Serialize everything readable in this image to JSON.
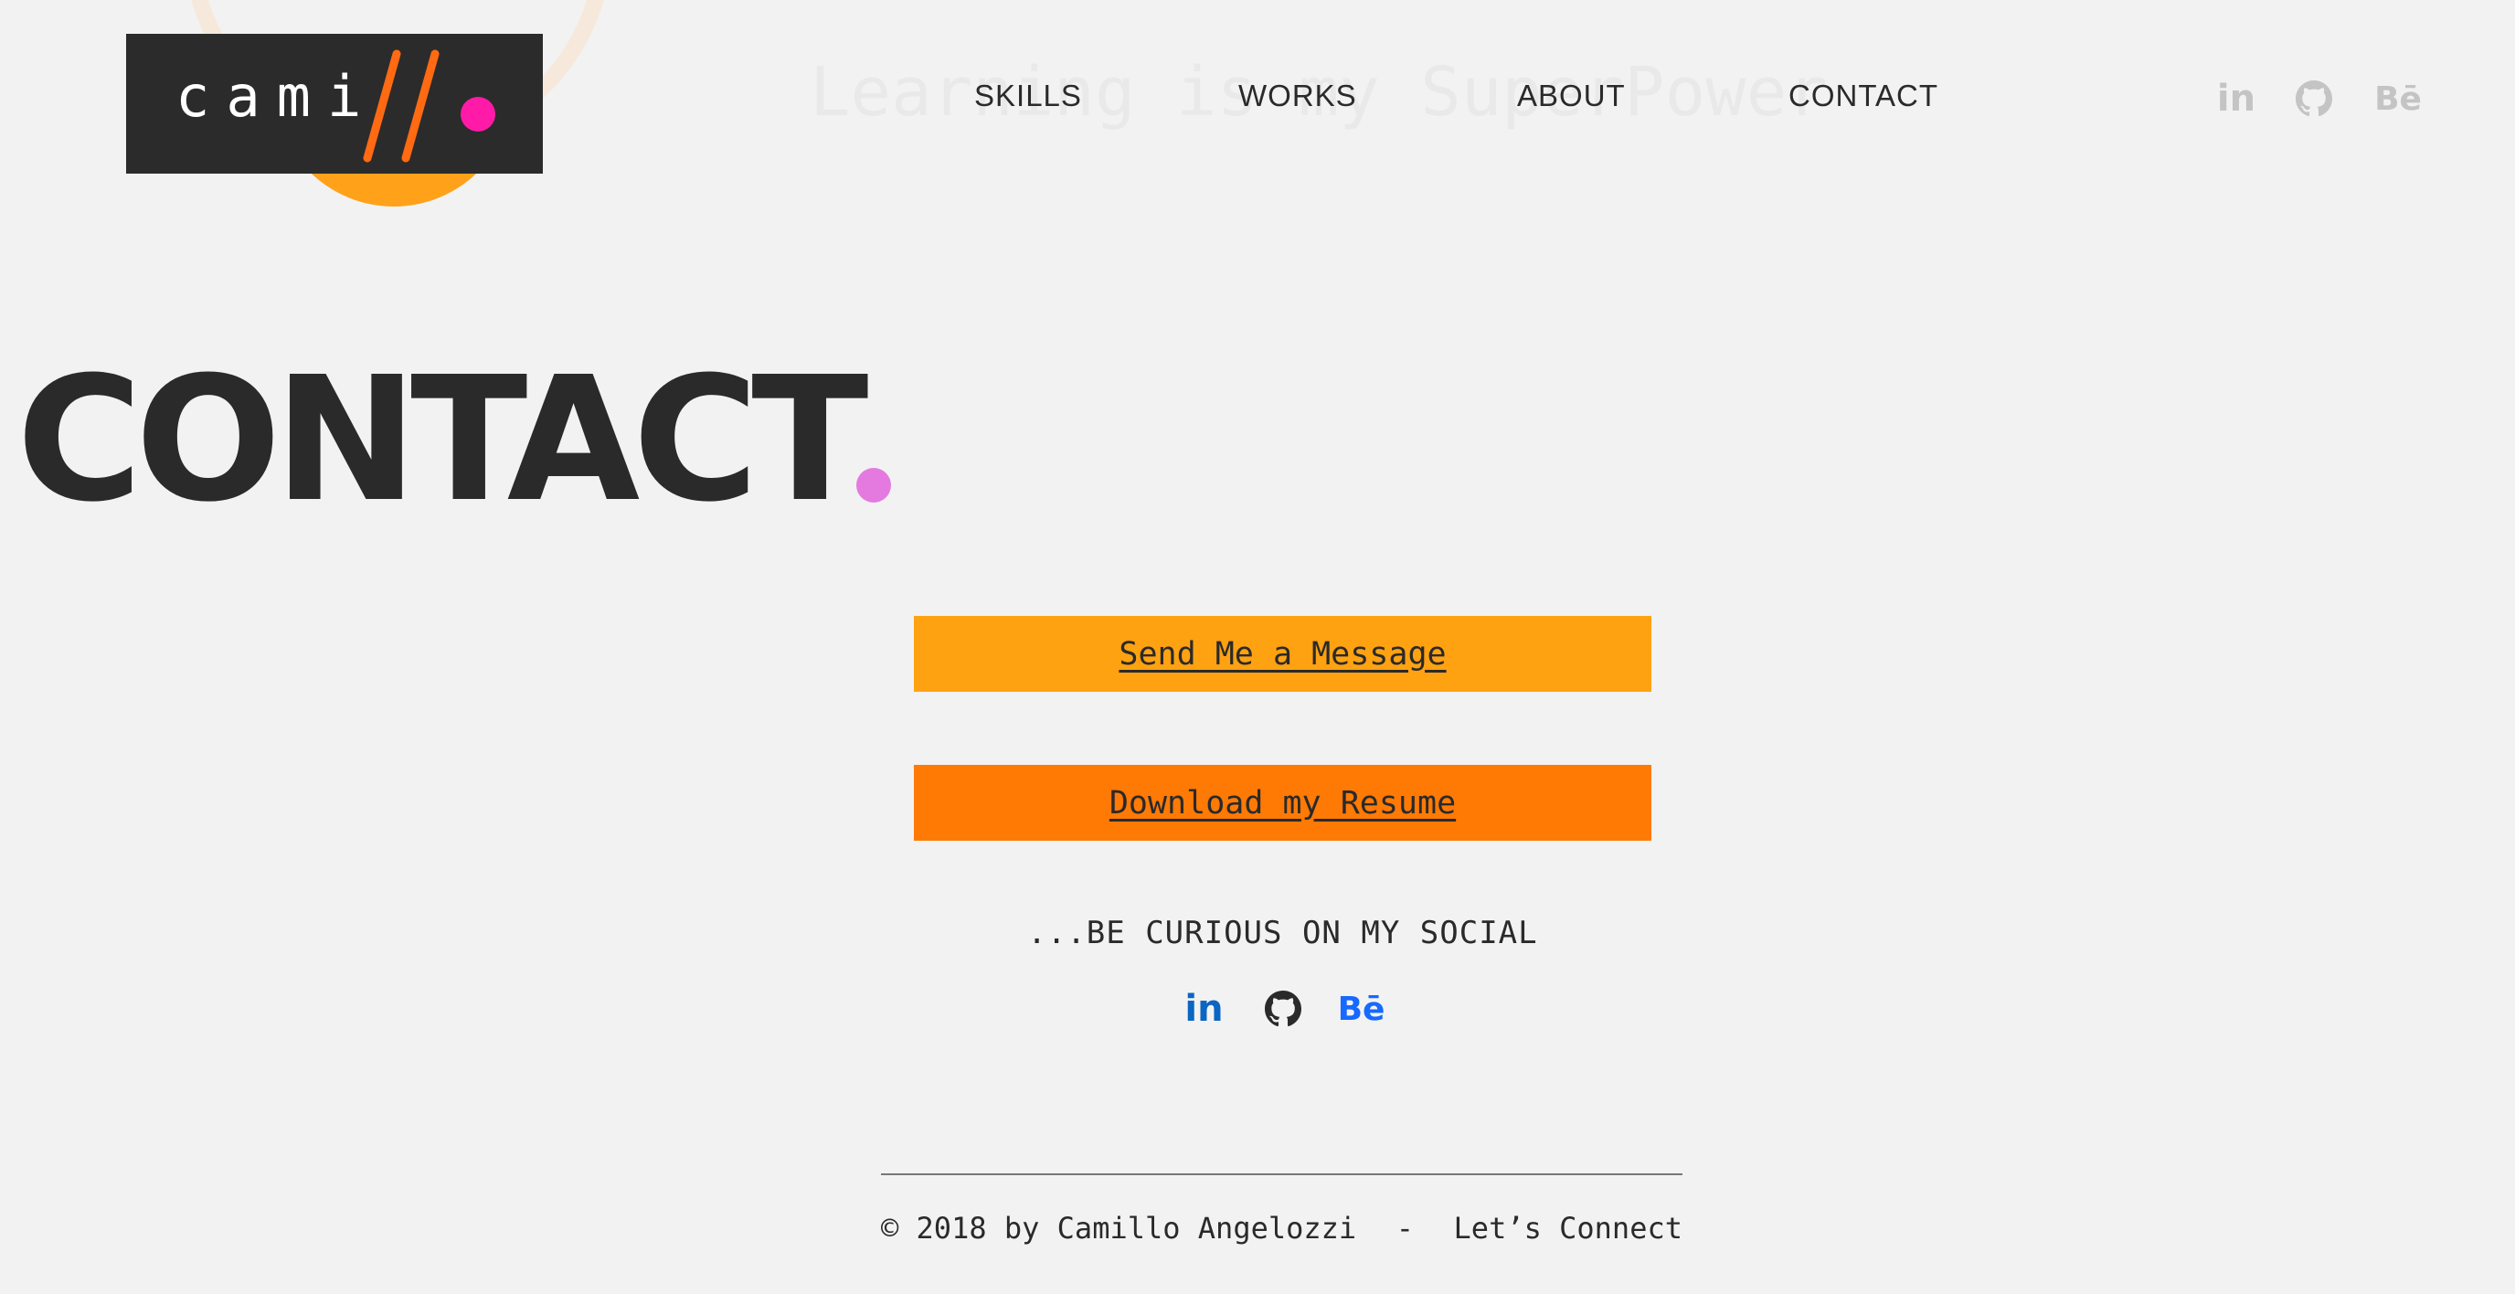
{
  "logo": {
    "text": "cami",
    "dot_color": "#ff1aa8",
    "slash_color": "#ff6a13",
    "accent_circle_color": "#ffa21a"
  },
  "header": {
    "tagline": "Learning is my SuperPower",
    "nav": [
      {
        "label": "SKILLS"
      },
      {
        "label": "WORKS"
      },
      {
        "label": "ABOUT"
      },
      {
        "label": "CONTACT"
      }
    ],
    "social": [
      {
        "icon": "linkedin-icon",
        "glyph": "in"
      },
      {
        "icon": "github-icon"
      },
      {
        "icon": "behance-icon",
        "glyph": "Bē"
      }
    ]
  },
  "main": {
    "title": "CONTACT",
    "title_dot_color": "#e47ae0",
    "buttons": [
      {
        "label": "Send Me a Message",
        "color": "#ffa211"
      },
      {
        "label": "Download my Resume",
        "color": "#ff7a05"
      }
    ],
    "social_heading": "...BE CURIOUS ON MY SOCIAL",
    "social": [
      {
        "icon": "linkedin-icon",
        "glyph": "in",
        "color": "#0a66c2"
      },
      {
        "icon": "github-icon",
        "color": "#2a2a2a"
      },
      {
        "icon": "behance-icon",
        "glyph": "Bē",
        "color": "#1769ff"
      }
    ]
  },
  "footer": {
    "copyright": "© 2018 by Camillo Angelozzi",
    "separator": "-",
    "link": "Let’s Connect"
  }
}
